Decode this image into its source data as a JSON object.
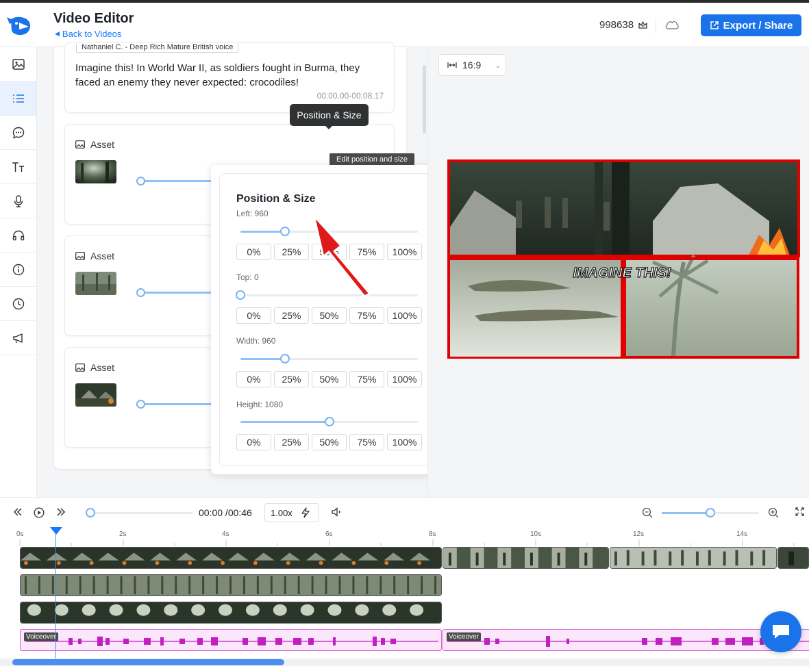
{
  "header": {
    "title": "Video Editor",
    "back_label": "Back to Videos",
    "credits": "998638",
    "export_label": "Export / Share"
  },
  "sidebar": {
    "items": [
      {
        "name": "image-icon"
      },
      {
        "name": "list-icon",
        "active": true
      },
      {
        "name": "chat-bubble-icon"
      },
      {
        "name": "text-size-icon"
      },
      {
        "name": "microphone-icon"
      },
      {
        "name": "headphones-icon"
      },
      {
        "name": "info-icon"
      },
      {
        "name": "clock-icon"
      },
      {
        "name": "megaphone-icon"
      }
    ]
  },
  "script_card": {
    "voice": "Nathaniel C. - Deep Rich Mature British voice",
    "text": "Imagine this! In World War II, as soldiers fought in Burma, they faced an enemy they never expected: crocodiles!",
    "timecode": "00:00.00-00:08.17"
  },
  "assets": [
    {
      "label": "Asset"
    },
    {
      "label": "Asset"
    },
    {
      "label": "Asset"
    }
  ],
  "tooltips": {
    "position_size": "Position & Size",
    "edit_position": "Edit position and size"
  },
  "popover": {
    "title": "Position & Size",
    "left_label": "Left: 960",
    "left_value": 0.25,
    "top_label": "Top: 0",
    "top_value": 0.0,
    "width_label": "Width: 960",
    "width_value": 0.25,
    "height_label": "Height: 1080",
    "height_value": 0.5,
    "presets": [
      "0%",
      "25%",
      "50%",
      "75%",
      "100%"
    ]
  },
  "preview": {
    "ratio": "16:9",
    "caption": "IMAGINE THIS!"
  },
  "controls": {
    "time": "00:00 /00:46",
    "speed": "1.00x",
    "zoom_level": 0.5
  },
  "timeline": {
    "ruler": [
      "0s",
      "2s",
      "4s",
      "6s",
      "8s",
      "10s",
      "12s",
      "14s"
    ],
    "voiceover_label": "Voiceover"
  },
  "colors": {
    "accent": "#1a73e8",
    "highlight_border": "#e00000",
    "audio": "#c21fc2"
  }
}
